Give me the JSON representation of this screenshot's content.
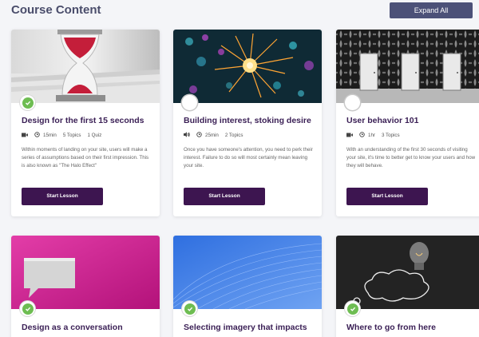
{
  "header": {
    "title": "Course Content",
    "expand_label": "Expand All"
  },
  "colors": {
    "accent": "#3d1550",
    "title": "#3a1f55",
    "complete": "#6ebd52",
    "expand_bg": "#4c5178"
  },
  "cards": [
    {
      "title": "Design for the first 15 seconds",
      "status": "complete",
      "media_icon": "video-icon",
      "duration": "15min",
      "topics": "5 Topics",
      "quiz": "1 Quiz",
      "description": "Within moments of landing on your site, users will make a series of assumptions based on their first impression. This is also known as \"The Halo Effect\"",
      "button": "Start Lesson",
      "thumb": "hourglass"
    },
    {
      "title": "Building interest, stoking desire",
      "status": "incomplete",
      "media_icon": "audio-icon",
      "duration": "25min",
      "topics": "2 Topics",
      "quiz": "",
      "description": "Once you have someone's attention, you need to perk their interest. Failure to do so will most certainly mean leaving your site.",
      "button": "Start Lesson",
      "thumb": "sparkler"
    },
    {
      "title": "User behavior 101",
      "status": "incomplete",
      "media_icon": "video-icon",
      "duration": "1hr",
      "topics": "3 Topics",
      "quiz": "",
      "description": "With an understanding of the first 30 seconds of visiting your site, it's time to better get to know your users and how they will behave.",
      "button": "Start Lesson",
      "thumb": "doors"
    },
    {
      "title": "Design as a conversation",
      "status": "complete",
      "thumb": "speech-bubble"
    },
    {
      "title": "Selecting imagery that impacts",
      "status": "complete",
      "thumb": "blue-waves"
    },
    {
      "title": "Where to go from here",
      "status": "complete",
      "thumb": "lightbulb"
    }
  ]
}
